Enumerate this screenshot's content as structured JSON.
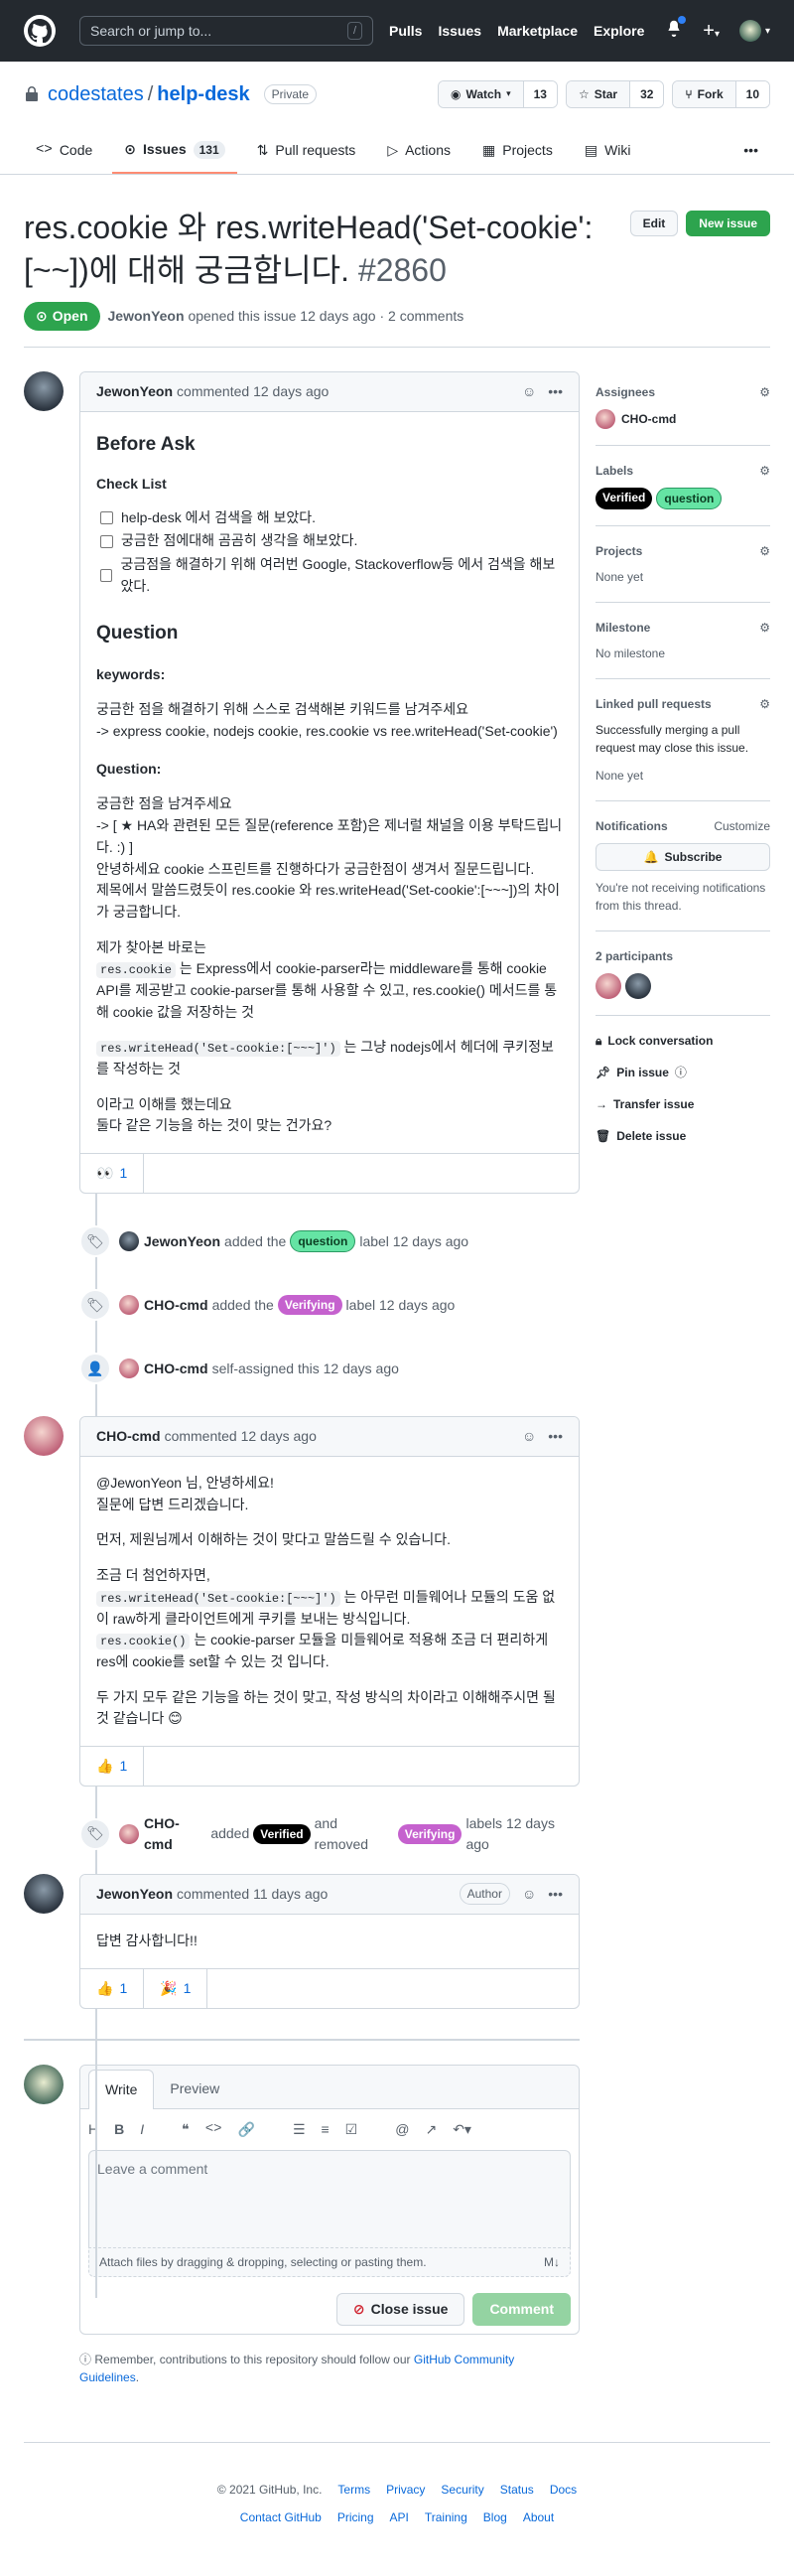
{
  "header": {
    "search_placeholder": "Search or jump to...",
    "search_key": "/",
    "nav": [
      "Pulls",
      "Issues",
      "Marketplace",
      "Explore"
    ],
    "plus": "+"
  },
  "repo": {
    "owner": "codestates",
    "sep": "/",
    "name": "help-desk",
    "visibility": "Private",
    "watch": {
      "label": "Watch",
      "count": "13"
    },
    "star": {
      "label": "Star",
      "count": "32"
    },
    "fork": {
      "label": "Fork",
      "count": "10"
    },
    "tabs": [
      {
        "label": "Code"
      },
      {
        "label": "Issues",
        "count": "131"
      },
      {
        "label": "Pull requests"
      },
      {
        "label": "Actions"
      },
      {
        "label": "Projects"
      },
      {
        "label": "Wiki"
      }
    ],
    "more": "•••"
  },
  "issue": {
    "title": "res.cookie 와 res.writeHead('Set-cookie': [~~])에 대해 궁금합니다.",
    "number": "#2860",
    "edit": "Edit",
    "new_issue": "New issue",
    "state": "Open",
    "author": "JewonYeon",
    "meta": "opened this issue 12 days ago · 2 comments"
  },
  "comments": [
    {
      "author": "JewonYeon",
      "time": "commented 12 days ago",
      "before_ask": "Before Ask",
      "checklist_title": "Check List",
      "tasks": [
        "help-desk 에서 검색을 해 보았다.",
        "궁금한 점에대해 곰곰히 생각을 해보았다.",
        "궁금점을 해결하기 위해 여러번 Google, Stackoverflow등 에서 검색을 해보았다."
      ],
      "question": "Question",
      "keywords_title": "keywords:",
      "keywords_1": "궁금한 점을 해결하기 위해 스스로 검색해본 키워드를 남겨주세요",
      "keywords_2": "-> express cookie, nodejs cookie, res.cookie vs ree.writeHead('Set-cookie')",
      "question_title": "Question:",
      "q1": "궁금한 점을 남겨주세요",
      "q2": "-> [ ★ HA와 관련된 모든 질문(reference 포함)은 제너럴 채널을 이용 부탁드립니다. :) ]",
      "q3": "안녕하세요 cookie 스프린트를 진행하다가 궁금한점이 생겨서 질문드립니다.",
      "q4": "제목에서 말씀드렸듯이 res.cookie 와 res.writeHead('Set-cookie':[~~~])의 차이가 궁금합니다.",
      "p_found": "제가 찾아본 바로는",
      "code1": "res.cookie",
      "p1": "는 Express에서 cookie-parser라는 middleware를 통해 cookie API를 제공받고 cookie-parser를 통해 사용할 수 있고, res.cookie() 메서드를 통해 cookie 값을 저장하는 것",
      "code2": "res.writeHead('Set-cookie:[~~~]')",
      "p2": "는 그냥 nodejs에서 헤더에 쿠키정보를 작성하는 것",
      "p3a": "이라고 이해를 했는데요",
      "p3b": "둘다 같은 기능을 하는 것이 맞는 건가요?",
      "reactions": [
        {
          "emoji": "👀",
          "count": "1"
        }
      ]
    },
    {
      "author": "CHO-cmd",
      "time": "commented 12 days ago",
      "l1": "@JewonYeon 님, 안녕하세요!",
      "l2": "질문에 답변 드리겠습니다.",
      "l3": "먼저, 제원님께서 이해하는 것이 맞다고 말씀드릴 수 있습니다.",
      "l4": "조금 더 첨언하자면,",
      "code1": "res.writeHead('Set-cookie:[~~~]')",
      "l5": "는 아무런 미들웨어나 모듈의 도움 없이 raw하게 클라이언트에게 쿠키를 보내는 방식입니다.",
      "code2": "res.cookie()",
      "l6": "는 cookie-parser 모듈을 미들웨어로 적용해 조금 더 편리하게 res에 cookie를 set할 수 있는 것 입니다.",
      "l7": "두 가지 모두 같은 기능을 하는 것이 맞고, 작성 방식의 차이라고 이해해주시면 될 것 같습니다 😊",
      "reactions": [
        {
          "emoji": "👍",
          "count": "1"
        }
      ]
    },
    {
      "author": "JewonYeon",
      "time": "commented 11 days ago",
      "badge": "Author",
      "body": "답변 감사합니다!!",
      "reactions": [
        {
          "emoji": "👍",
          "count": "1"
        },
        {
          "emoji": "🎉",
          "count": "1"
        }
      ]
    }
  ],
  "events": [
    {
      "actor": "JewonYeon",
      "a": "added the",
      "label": "question",
      "b": "label 12 days ago"
    },
    {
      "actor": "CHO-cmd",
      "a": "added the",
      "label": "Verifying",
      "b": "label 12 days ago"
    },
    {
      "actor": "CHO-cmd",
      "a": "self-assigned this 12 days ago"
    },
    {
      "actor": "CHO-cmd",
      "a": "added",
      "label1": "Verified",
      "mid": "and removed",
      "label2": "Verifying",
      "b": "labels 12 days ago"
    }
  ],
  "sidebar": {
    "assignees": {
      "title": "Assignees",
      "value": "CHO-cmd"
    },
    "labels": {
      "title": "Labels",
      "items": [
        "Verified",
        "question"
      ]
    },
    "projects": {
      "title": "Projects",
      "value": "None yet"
    },
    "milestone": {
      "title": "Milestone",
      "value": "No milestone"
    },
    "linked": {
      "title": "Linked pull requests",
      "desc": "Successfully merging a pull request may close this issue.",
      "value": "None yet"
    },
    "notifications": {
      "title": "Notifications",
      "customize": "Customize",
      "subscribe": "Subscribe",
      "desc": "You're not receiving notifications from this thread."
    },
    "participants": {
      "title": "2 participants"
    },
    "actions": [
      "Lock conversation",
      "Pin issue",
      "Transfer issue",
      "Delete issue"
    ]
  },
  "composer": {
    "tab_write": "Write",
    "tab_preview": "Preview",
    "placeholder": "Leave a comment",
    "attach": "Attach files by dragging & dropping, selecting or pasting them.",
    "md": "M↓",
    "close": "Close issue",
    "submit": "Comment",
    "tip_a": "Remember, contributions to this repository should follow our",
    "tip_link": "GitHub Community Guidelines",
    "tip_b": "."
  },
  "footer": {
    "row1": [
      "© 2021 GitHub, Inc.",
      "Terms",
      "Privacy",
      "Security",
      "Status",
      "Docs"
    ],
    "row2": [
      "Contact GitHub",
      "Pricing",
      "API",
      "Training",
      "Blog",
      "About"
    ]
  },
  "colors": {
    "open": "#2da44e",
    "question": "#65e4a4",
    "verifying": "#c561ce",
    "verified": "#000000",
    "link": "#0969da"
  }
}
